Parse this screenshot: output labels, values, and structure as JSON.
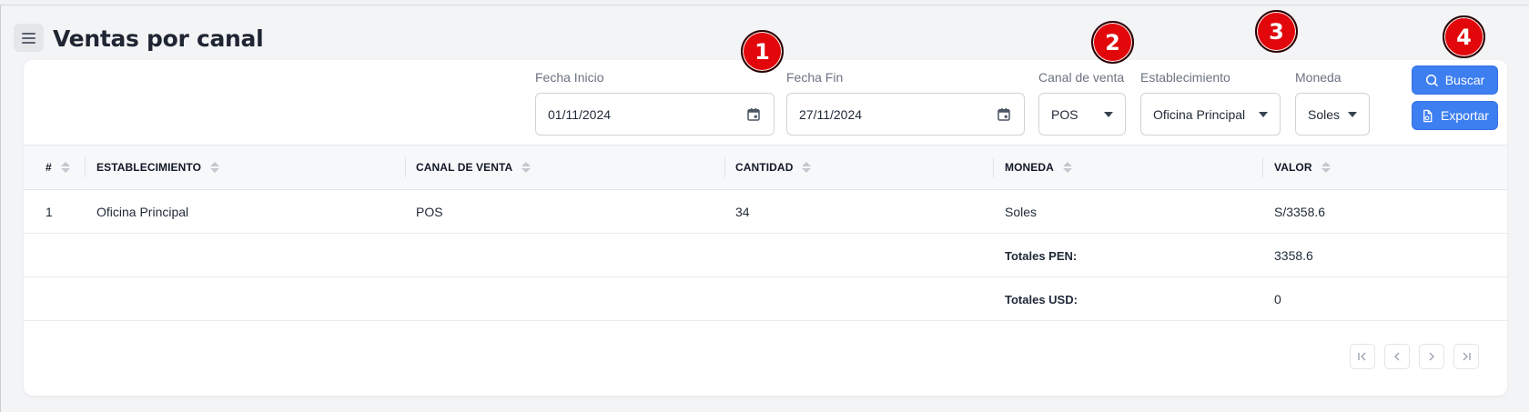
{
  "page": {
    "title": "Ventas por canal"
  },
  "filters": {
    "fecha_inicio": {
      "label": "Fecha Inicio",
      "value": "01/11/2024"
    },
    "fecha_fin": {
      "label": "Fecha Fin",
      "value": "27/11/2024"
    },
    "canal": {
      "label": "Canal de venta",
      "value": "POS"
    },
    "establecimiento": {
      "label": "Establecimiento",
      "value": "Oficina Principal"
    },
    "moneda": {
      "label": "Moneda",
      "value": "Soles"
    }
  },
  "actions": {
    "buscar": "Buscar",
    "exportar": "Exportar"
  },
  "markers": [
    "1",
    "2",
    "3",
    "4"
  ],
  "table": {
    "headers": [
      "#",
      "ESTABLECIMIENTO",
      "CANAL DE VENTA",
      "CANTIDAD",
      "MONEDA",
      "VALOR"
    ],
    "rows": [
      {
        "num": "1",
        "establecimiento": "Oficina Principal",
        "canal": "POS",
        "cantidad": "34",
        "moneda": "Soles",
        "valor": "S/3358.6"
      }
    ],
    "totals": [
      {
        "label": "Totales PEN:",
        "value": "3358.6"
      },
      {
        "label": "Totales USD:",
        "value": "0"
      }
    ]
  },
  "pagination": {
    "icons": [
      "first-page-icon",
      "prev-page-icon",
      "next-page-icon",
      "last-page-icon"
    ]
  },
  "colors": {
    "accent": "#3d7ff0",
    "marker": "#e1070b",
    "background": "#f3f4f6"
  }
}
